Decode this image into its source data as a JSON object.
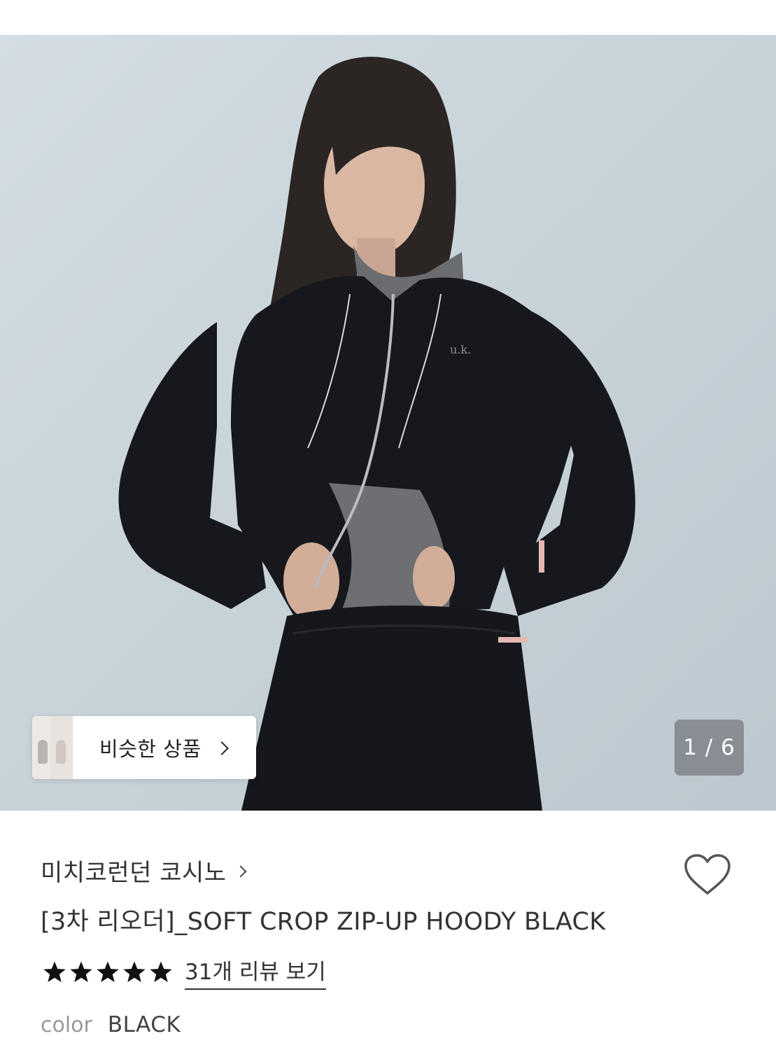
{
  "product_image": {
    "logo_text": "u.k.",
    "similar_products_label": "비슷한 상품",
    "counter": "1 / 6"
  },
  "info": {
    "brand": "미치코런던 코시노",
    "title": "[3차 리오더]_SOFT CROP ZIP-UP HOODY BLACK",
    "rating_stars": 5,
    "review_link": "31개 리뷰 보기",
    "color_label": "color",
    "color_value": "BLACK"
  },
  "icons": {
    "similar_chevron": "chevron-right-icon",
    "brand_chevron": "chevron-right-icon",
    "wishlist": "heart-icon",
    "star": "star-icon"
  }
}
